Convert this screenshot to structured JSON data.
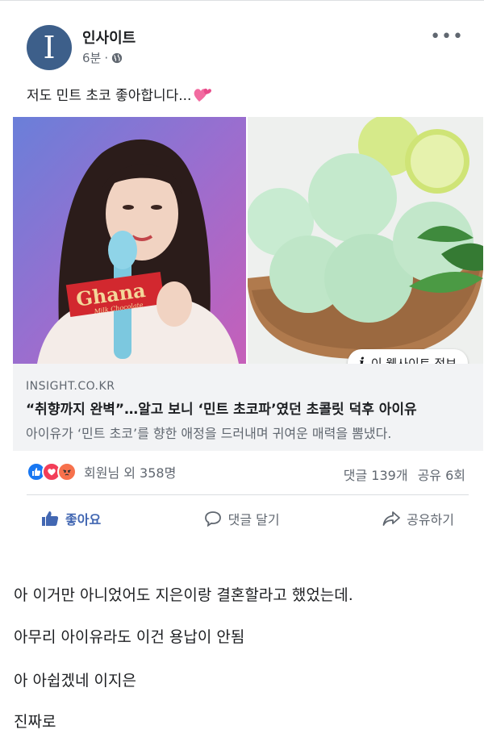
{
  "post": {
    "author": "인사이트",
    "avatar_letter": "I",
    "time": "6분",
    "separator": "·",
    "text": "저도 민트 초코 좋아합니다...",
    "more_label": "•••",
    "image_left_alt": "아이유 Ghana Milk Chocolate",
    "image_right_alt": "민트 아이스크림",
    "info_badge": "이 웹사이트 정보",
    "info_icon": "i"
  },
  "link": {
    "domain": "INSIGHT.CO.KR",
    "title": "“취향까지 완벽”…알고 보니 ‘민트 초코파’였던 초콜릿 덕후 아이유",
    "description": "아이유가 ‘민트 초코’를 향한 애정을 드러내며 귀여운 매력을 뽐냈다."
  },
  "stats": {
    "reaction_text": "회원님 외 358명",
    "comments": "댓글 139개",
    "shares": "공유 6회"
  },
  "actions": {
    "like": "좋아요",
    "comment": "댓글 달기",
    "share": "공유하기"
  },
  "body_lines": [
    "아 이거만 아니었어도 지은이랑 결혼할라고 했었는데.",
    "아무리 아이유라도 이건 용납이 안됨",
    "아 아쉽겠네 이지은",
    "진짜로"
  ],
  "colors": {
    "brand_blue": "#4267b2",
    "avatar_bg": "#3d5f8a",
    "like_reaction": "#1877f2",
    "love_reaction": "#f33e58",
    "angry_reaction": "#f7714c"
  },
  "icons": [
    "globe-icon",
    "more-icon",
    "heart-emoji",
    "info-icon",
    "like-reaction-icon",
    "love-reaction-icon",
    "angry-reaction-icon",
    "thumbs-up-icon",
    "comment-icon",
    "share-icon"
  ]
}
